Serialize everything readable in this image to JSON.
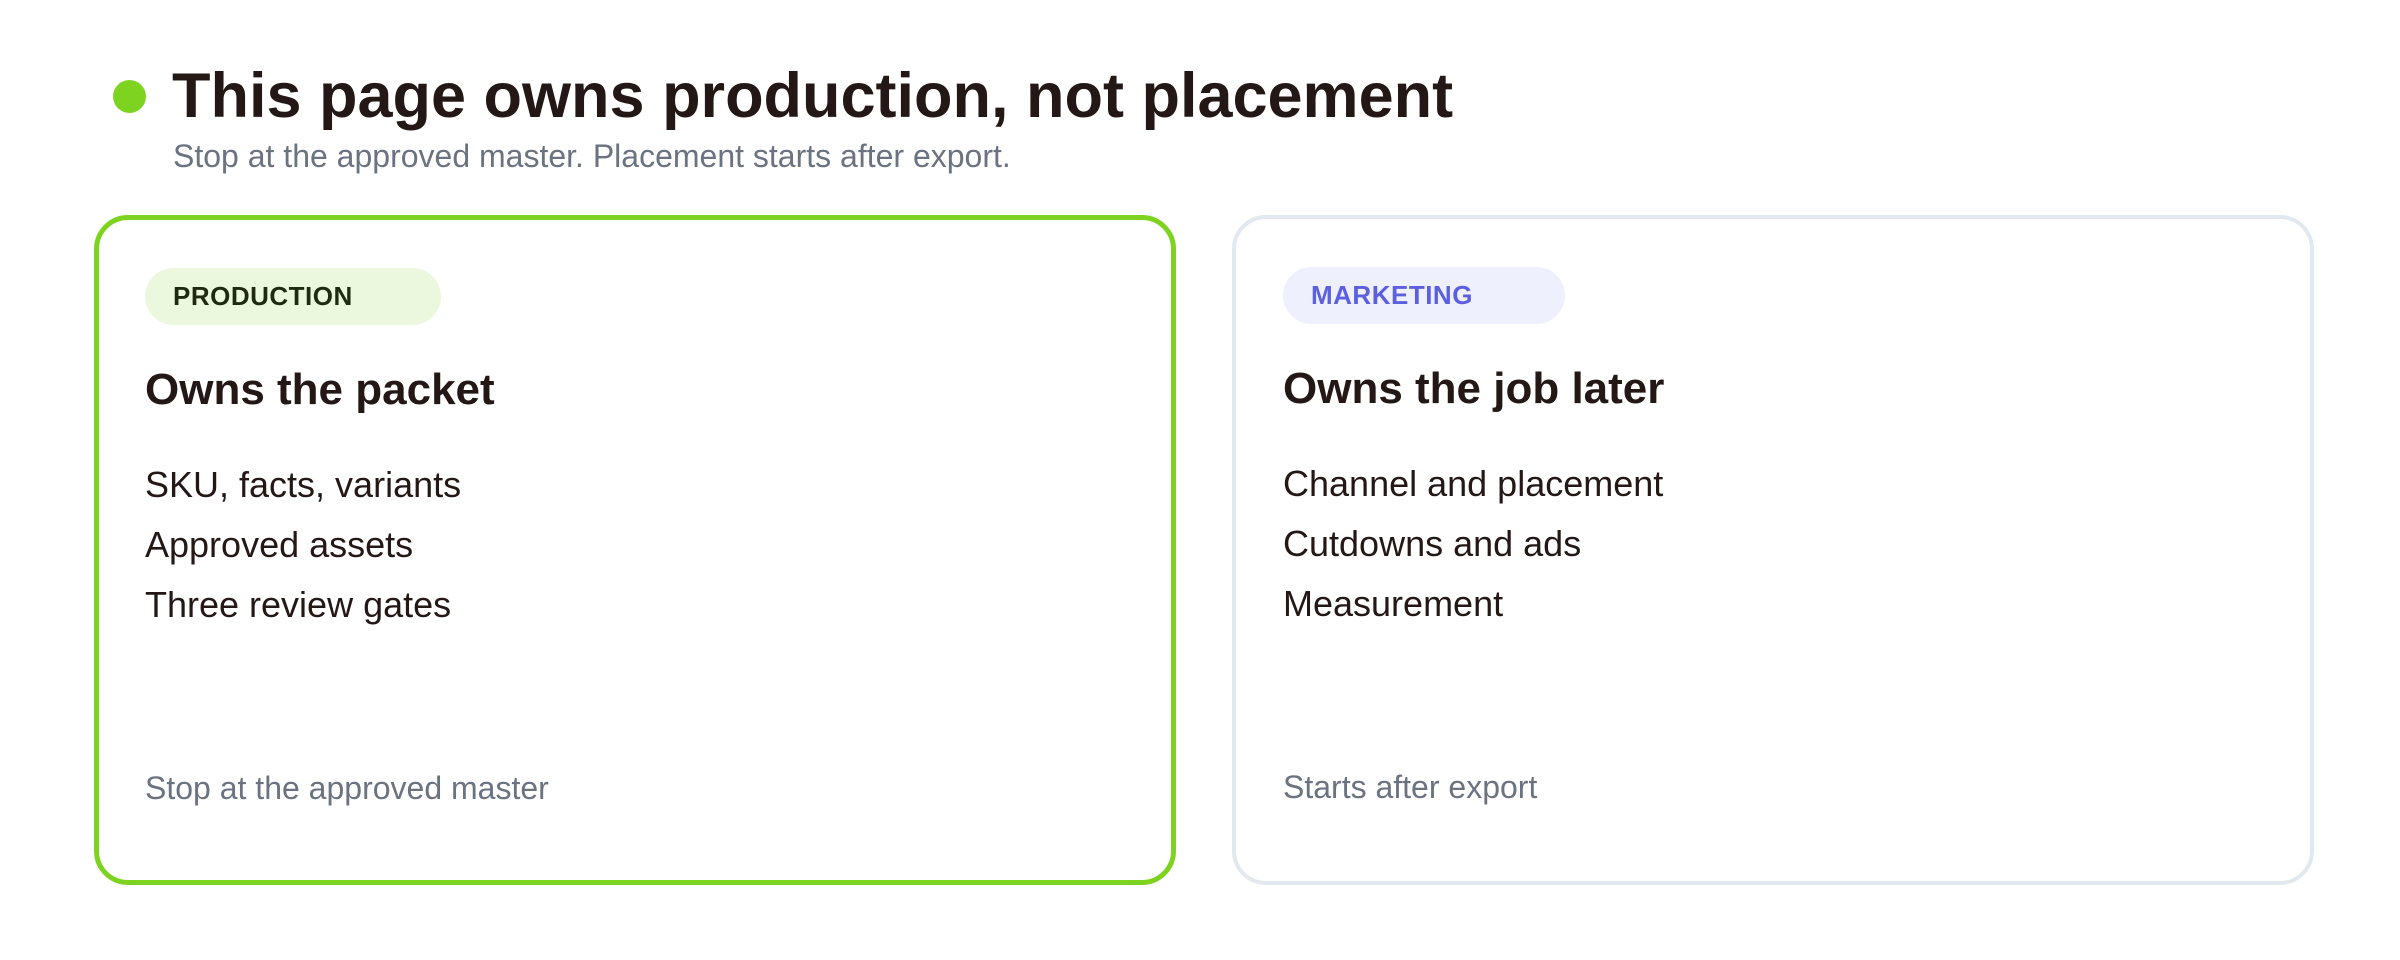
{
  "header": {
    "title": "This page owns production, not placement",
    "subtitle": "Stop at the approved master. Placement starts after export.",
    "status_icon": "status-dot-icon"
  },
  "cards": [
    {
      "badge": "PRODUCTION",
      "title": "Owns the packet",
      "items": [
        "SKU, facts, variants",
        "Approved assets",
        "Three review gates"
      ],
      "footer": "Stop at the approved master"
    },
    {
      "badge": "MARKETING",
      "title": "Owns the job later",
      "items": [
        "Channel and placement",
        "Cutdowns and ads",
        "Measurement"
      ],
      "footer": "Starts after export"
    }
  ],
  "colors": {
    "accent_green": "#7ed321",
    "production_badge_bg": "#ecf8dd",
    "marketing_badge_bg": "#eef0fe",
    "marketing_badge_text": "#5b5fe0",
    "marketing_border": "#e2e8f0",
    "text_primary": "#231815",
    "text_muted": "#6b7280"
  }
}
